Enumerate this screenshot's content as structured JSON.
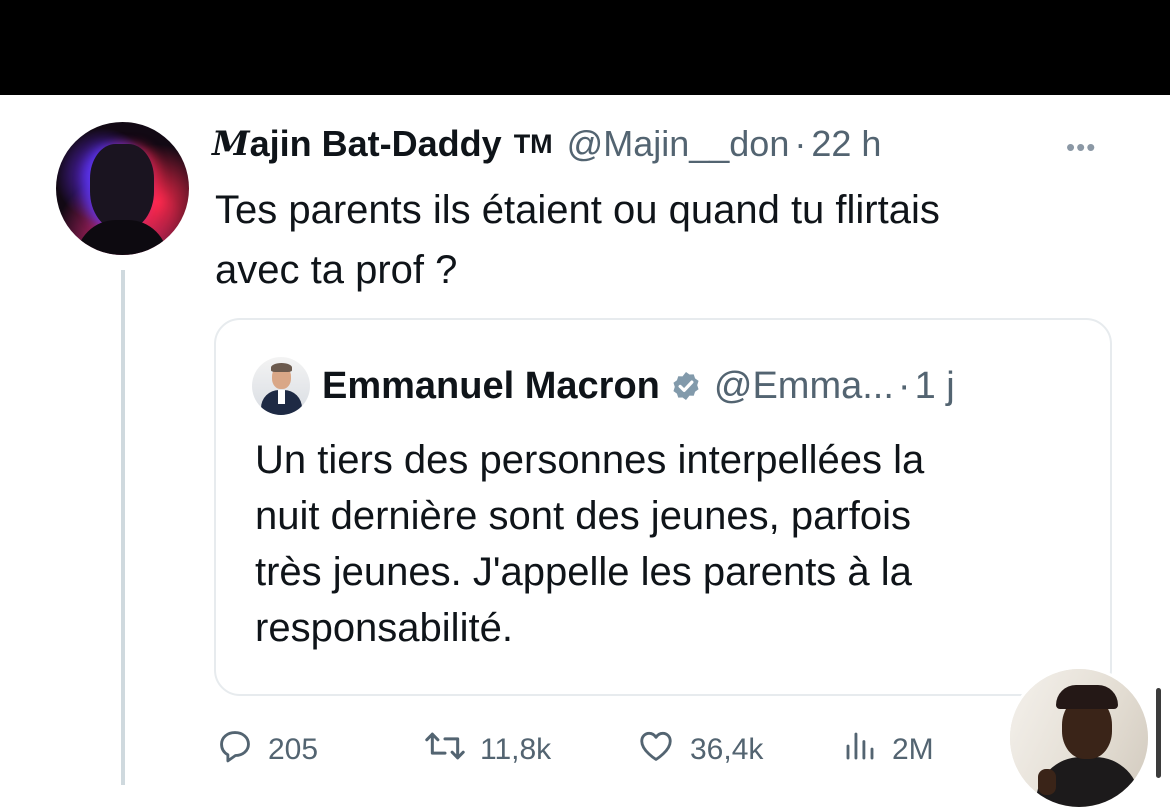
{
  "tweet": {
    "author_name_first": "M",
    "author_name_rest": "ajin Bat-Daddy",
    "author_badge": "TM",
    "handle": "@Majin__don",
    "separator": "·",
    "time": "22 h",
    "text": "Tes parents ils étaient ou quand tu flirtais\navec ta prof ?"
  },
  "quoted": {
    "author_name": "Emmanuel Macron",
    "handle": "@Emma...",
    "separator": "·",
    "time": "1 j",
    "text": "Un tiers des personnes interpellées la\nnuit dernière sont des jeunes, parfois\ntrès jeunes. J'appelle les parents à la\nresponsabilité."
  },
  "actions": {
    "replies": "205",
    "retweets": "11,8k",
    "likes": "36,4k",
    "views": "2M"
  },
  "icons": {
    "more": "more-horizontal-icon",
    "verified": "verified-badge-icon",
    "reply": "reply-icon",
    "retweet": "retweet-icon",
    "like": "heart-icon",
    "views": "views-chart-icon"
  },
  "colors": {
    "text": "#0f1419",
    "secondary": "#536471",
    "border": "#e7ebee",
    "verified": "#829aab"
  }
}
